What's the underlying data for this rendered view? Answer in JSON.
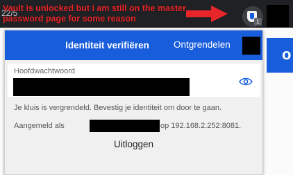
{
  "browser": {
    "tab_fragment": "22/5",
    "annotation": "Vault is unlocked but i am still on the master password page for some reason",
    "extension_badge": "1"
  },
  "background": {
    "letter": "o"
  },
  "popup": {
    "title": "Identiteit verifiëren",
    "unlock_label": "Ontgrendelen",
    "password_label": "Hoofdwachtwoord",
    "info_text": "Je kluis is vergrendeld. Bevestig je identiteit om door te gaan.",
    "logged_in_prefix": "Aangemeld als",
    "logged_in_suffix": "op 192.168.2.252:8081.",
    "logout_label": "Uitloggen"
  },
  "colors": {
    "brand_blue": "#175ddc",
    "annotation_red": "#e8262a"
  }
}
